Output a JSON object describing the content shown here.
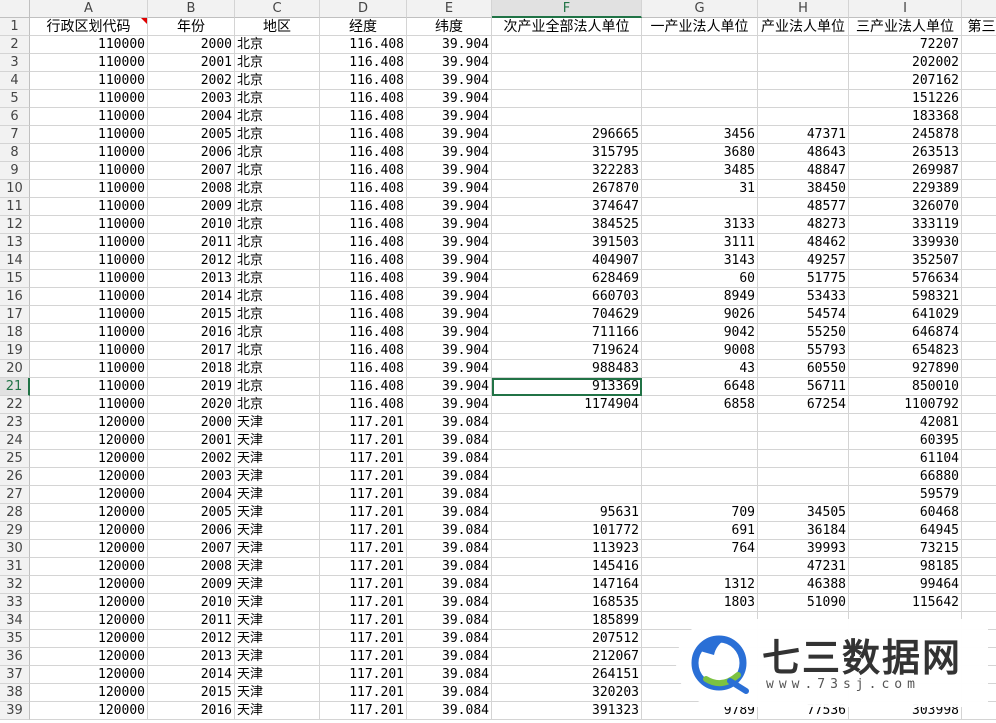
{
  "sheet": {
    "columns": [
      "A",
      "B",
      "C",
      "D",
      "E",
      "F",
      "G",
      "H",
      "I",
      ""
    ],
    "headers": [
      "行政区划代码",
      "年份",
      "地区",
      "经度",
      "纬度",
      "次产业全部法人单位",
      "一产业法人单位",
      "产业法人单位",
      "三产业法人单位",
      "第三"
    ],
    "selected_column": "F",
    "selected_row": 21,
    "rows": [
      {
        "n": 2,
        "a": "110000",
        "b": "2000",
        "c": "北京",
        "d": "116.408",
        "e": "39.904",
        "f": "",
        "g": "",
        "h": "",
        "i": "72207"
      },
      {
        "n": 3,
        "a": "110000",
        "b": "2001",
        "c": "北京",
        "d": "116.408",
        "e": "39.904",
        "f": "",
        "g": "",
        "h": "",
        "i": "202002"
      },
      {
        "n": 4,
        "a": "110000",
        "b": "2002",
        "c": "北京",
        "d": "116.408",
        "e": "39.904",
        "f": "",
        "g": "",
        "h": "",
        "i": "207162"
      },
      {
        "n": 5,
        "a": "110000",
        "b": "2003",
        "c": "北京",
        "d": "116.408",
        "e": "39.904",
        "f": "",
        "g": "",
        "h": "",
        "i": "151226"
      },
      {
        "n": 6,
        "a": "110000",
        "b": "2004",
        "c": "北京",
        "d": "116.408",
        "e": "39.904",
        "f": "",
        "g": "",
        "h": "",
        "i": "183368"
      },
      {
        "n": 7,
        "a": "110000",
        "b": "2005",
        "c": "北京",
        "d": "116.408",
        "e": "39.904",
        "f": "296665",
        "g": "3456",
        "h": "47371",
        "i": "245878"
      },
      {
        "n": 8,
        "a": "110000",
        "b": "2006",
        "c": "北京",
        "d": "116.408",
        "e": "39.904",
        "f": "315795",
        "g": "3680",
        "h": "48643",
        "i": "263513"
      },
      {
        "n": 9,
        "a": "110000",
        "b": "2007",
        "c": "北京",
        "d": "116.408",
        "e": "39.904",
        "f": "322283",
        "g": "3485",
        "h": "48847",
        "i": "269987"
      },
      {
        "n": 10,
        "a": "110000",
        "b": "2008",
        "c": "北京",
        "d": "116.408",
        "e": "39.904",
        "f": "267870",
        "g": "31",
        "h": "38450",
        "i": "229389"
      },
      {
        "n": 11,
        "a": "110000",
        "b": "2009",
        "c": "北京",
        "d": "116.408",
        "e": "39.904",
        "f": "374647",
        "g": "",
        "h": "48577",
        "i": "326070"
      },
      {
        "n": 12,
        "a": "110000",
        "b": "2010",
        "c": "北京",
        "d": "116.408",
        "e": "39.904",
        "f": "384525",
        "g": "3133",
        "h": "48273",
        "i": "333119"
      },
      {
        "n": 13,
        "a": "110000",
        "b": "2011",
        "c": "北京",
        "d": "116.408",
        "e": "39.904",
        "f": "391503",
        "g": "3111",
        "h": "48462",
        "i": "339930"
      },
      {
        "n": 14,
        "a": "110000",
        "b": "2012",
        "c": "北京",
        "d": "116.408",
        "e": "39.904",
        "f": "404907",
        "g": "3143",
        "h": "49257",
        "i": "352507"
      },
      {
        "n": 15,
        "a": "110000",
        "b": "2013",
        "c": "北京",
        "d": "116.408",
        "e": "39.904",
        "f": "628469",
        "g": "60",
        "h": "51775",
        "i": "576634"
      },
      {
        "n": 16,
        "a": "110000",
        "b": "2014",
        "c": "北京",
        "d": "116.408",
        "e": "39.904",
        "f": "660703",
        "g": "8949",
        "h": "53433",
        "i": "598321"
      },
      {
        "n": 17,
        "a": "110000",
        "b": "2015",
        "c": "北京",
        "d": "116.408",
        "e": "39.904",
        "f": "704629",
        "g": "9026",
        "h": "54574",
        "i": "641029"
      },
      {
        "n": 18,
        "a": "110000",
        "b": "2016",
        "c": "北京",
        "d": "116.408",
        "e": "39.904",
        "f": "711166",
        "g": "9042",
        "h": "55250",
        "i": "646874"
      },
      {
        "n": 19,
        "a": "110000",
        "b": "2017",
        "c": "北京",
        "d": "116.408",
        "e": "39.904",
        "f": "719624",
        "g": "9008",
        "h": "55793",
        "i": "654823"
      },
      {
        "n": 20,
        "a": "110000",
        "b": "2018",
        "c": "北京",
        "d": "116.408",
        "e": "39.904",
        "f": "988483",
        "g": "43",
        "h": "60550",
        "i": "927890"
      },
      {
        "n": 21,
        "a": "110000",
        "b": "2019",
        "c": "北京",
        "d": "116.408",
        "e": "39.904",
        "f": "913369",
        "g": "6648",
        "h": "56711",
        "i": "850010"
      },
      {
        "n": 22,
        "a": "110000",
        "b": "2020",
        "c": "北京",
        "d": "116.408",
        "e": "39.904",
        "f": "1174904",
        "g": "6858",
        "h": "67254",
        "i": "1100792"
      },
      {
        "n": 23,
        "a": "120000",
        "b": "2000",
        "c": "天津",
        "d": "117.201",
        "e": "39.084",
        "f": "",
        "g": "",
        "h": "",
        "i": "42081"
      },
      {
        "n": 24,
        "a": "120000",
        "b": "2001",
        "c": "天津",
        "d": "117.201",
        "e": "39.084",
        "f": "",
        "g": "",
        "h": "",
        "i": "60395"
      },
      {
        "n": 25,
        "a": "120000",
        "b": "2002",
        "c": "天津",
        "d": "117.201",
        "e": "39.084",
        "f": "",
        "g": "",
        "h": "",
        "i": "61104"
      },
      {
        "n": 26,
        "a": "120000",
        "b": "2003",
        "c": "天津",
        "d": "117.201",
        "e": "39.084",
        "f": "",
        "g": "",
        "h": "",
        "i": "66880"
      },
      {
        "n": 27,
        "a": "120000",
        "b": "2004",
        "c": "天津",
        "d": "117.201",
        "e": "39.084",
        "f": "",
        "g": "",
        "h": "",
        "i": "59579"
      },
      {
        "n": 28,
        "a": "120000",
        "b": "2005",
        "c": "天津",
        "d": "117.201",
        "e": "39.084",
        "f": "95631",
        "g": "709",
        "h": "34505",
        "i": "60468"
      },
      {
        "n": 29,
        "a": "120000",
        "b": "2006",
        "c": "天津",
        "d": "117.201",
        "e": "39.084",
        "f": "101772",
        "g": "691",
        "h": "36184",
        "i": "64945"
      },
      {
        "n": 30,
        "a": "120000",
        "b": "2007",
        "c": "天津",
        "d": "117.201",
        "e": "39.084",
        "f": "113923",
        "g": "764",
        "h": "39993",
        "i": "73215"
      },
      {
        "n": 31,
        "a": "120000",
        "b": "2008",
        "c": "天津",
        "d": "117.201",
        "e": "39.084",
        "f": "145416",
        "g": "",
        "h": "47231",
        "i": "98185"
      },
      {
        "n": 32,
        "a": "120000",
        "b": "2009",
        "c": "天津",
        "d": "117.201",
        "e": "39.084",
        "f": "147164",
        "g": "1312",
        "h": "46388",
        "i": "99464"
      },
      {
        "n": 33,
        "a": "120000",
        "b": "2010",
        "c": "天津",
        "d": "117.201",
        "e": "39.084",
        "f": "168535",
        "g": "1803",
        "h": "51090",
        "i": "115642"
      },
      {
        "n": 34,
        "a": "120000",
        "b": "2011",
        "c": "天津",
        "d": "117.201",
        "e": "39.084",
        "f": "185899",
        "g": "",
        "h": "",
        "i": ""
      },
      {
        "n": 35,
        "a": "120000",
        "b": "2012",
        "c": "天津",
        "d": "117.201",
        "e": "39.084",
        "f": "207512",
        "g": "",
        "h": "",
        "i": ""
      },
      {
        "n": 36,
        "a": "120000",
        "b": "2013",
        "c": "天津",
        "d": "117.201",
        "e": "39.084",
        "f": "212067",
        "g": "",
        "h": "",
        "i": ""
      },
      {
        "n": 37,
        "a": "120000",
        "b": "2014",
        "c": "天津",
        "d": "117.201",
        "e": "39.084",
        "f": "264151",
        "g": "",
        "h": "",
        "i": ""
      },
      {
        "n": 38,
        "a": "120000",
        "b": "2015",
        "c": "天津",
        "d": "117.201",
        "e": "39.084",
        "f": "320203",
        "g": "",
        "h": "",
        "i": ""
      },
      {
        "n": 39,
        "a": "120000",
        "b": "2016",
        "c": "天津",
        "d": "117.201",
        "e": "39.084",
        "f": "391323",
        "g": "9789",
        "h": "77536",
        "i": "303998"
      }
    ]
  },
  "watermark": {
    "title": "七三数据网",
    "subtitle": "www.73sj.com",
    "colors": {
      "blue": "#2a6fd6",
      "green": "#7cc242",
      "text": "#333333"
    }
  },
  "colors": {
    "accent": "#217346",
    "grid": "#d4d4d4",
    "header_bg": "#f2f2f2",
    "comment": "#e00000"
  }
}
